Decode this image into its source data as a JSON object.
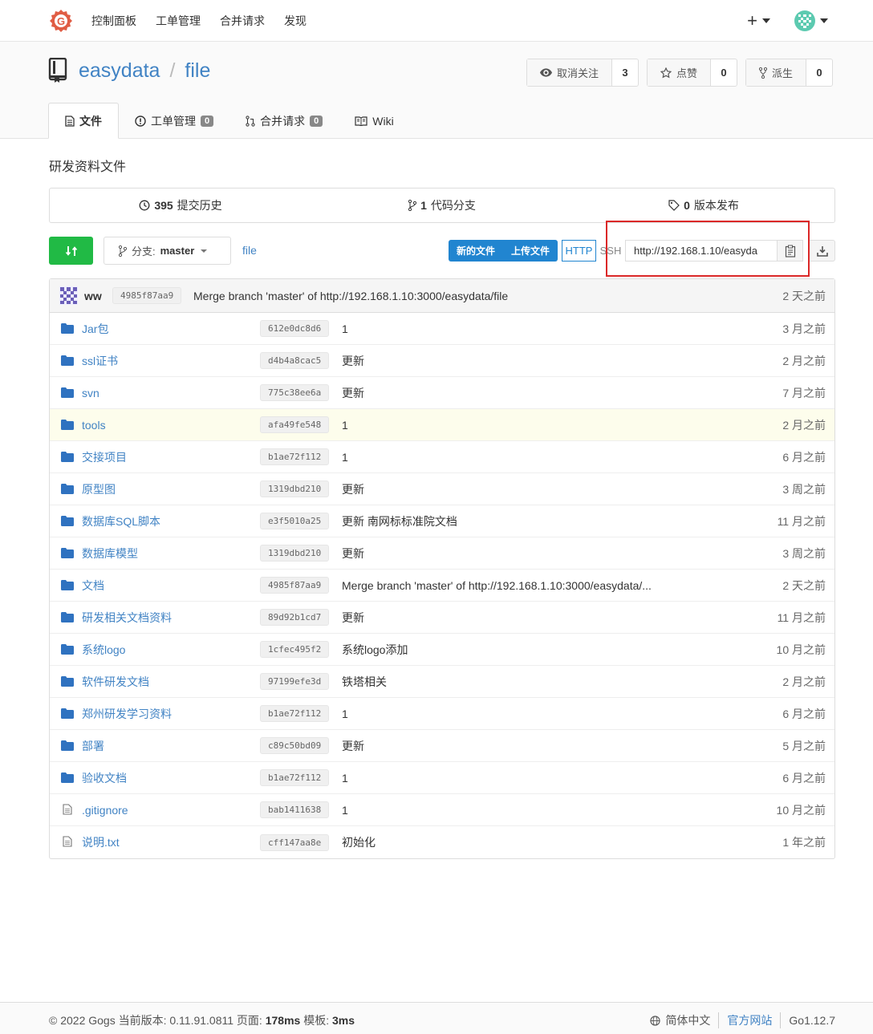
{
  "nav": {
    "items": [
      "控制面板",
      "工单管理",
      "合并请求",
      "发现"
    ],
    "plus": "+"
  },
  "repo": {
    "owner": "easydata",
    "separator": "/",
    "name": "file",
    "description": "研发资料文件",
    "watch": {
      "label": "取消关注",
      "count": "3"
    },
    "star": {
      "label": "点赞",
      "count": "0"
    },
    "fork": {
      "label": "派生",
      "count": "0"
    }
  },
  "tabs": [
    {
      "label": "文件",
      "active": true
    },
    {
      "label": "工单管理",
      "badge": "0"
    },
    {
      "label": "合并请求",
      "badge": "0"
    },
    {
      "label": "Wiki"
    }
  ],
  "stats": {
    "commits": {
      "count": "395",
      "label": "提交历史"
    },
    "branches": {
      "count": "1",
      "label": "代码分支"
    },
    "releases": {
      "count": "0",
      "label": "版本发布"
    }
  },
  "toolbar": {
    "branch_prefix": "分支:",
    "branch": "master",
    "path": "file",
    "new_file": "新的文件",
    "upload_file": "上传文件",
    "http": "HTTP",
    "ssh": "SSH",
    "clone_url": "http://192.168.1.10/easyda"
  },
  "latest_commit": {
    "user": "ww",
    "sha": "4985f87aa9",
    "message": "Merge branch 'master' of http://192.168.1.10:3000/easydata/file",
    "time": "2 天之前"
  },
  "files": [
    {
      "name": "Jar包",
      "type": "dir",
      "sha": "612e0dc8d6",
      "message": "1",
      "time": "3 月之前"
    },
    {
      "name": "ssl证书",
      "type": "dir",
      "sha": "d4b4a8cac5",
      "message": "更新",
      "time": "2 月之前"
    },
    {
      "name": "svn",
      "type": "dir",
      "sha": "775c38ee6a",
      "message": "更新",
      "time": "7 月之前"
    },
    {
      "name": "tools",
      "type": "dir",
      "sha": "afa49fe548",
      "message": "1",
      "time": "2 月之前"
    },
    {
      "name": "交接项目",
      "type": "dir",
      "sha": "b1ae72f112",
      "message": "1",
      "time": "6 月之前"
    },
    {
      "name": "原型图",
      "type": "dir",
      "sha": "1319dbd210",
      "message": "更新",
      "time": "3 周之前"
    },
    {
      "name": "数据库SQL脚本",
      "type": "dir",
      "sha": "e3f5010a25",
      "message": "更新 南网标标准院文档",
      "time": "11 月之前"
    },
    {
      "name": "数据库模型",
      "type": "dir",
      "sha": "1319dbd210",
      "message": "更新",
      "time": "3 周之前"
    },
    {
      "name": "文档",
      "type": "dir",
      "sha": "4985f87aa9",
      "message": "Merge branch 'master' of http://192.168.1.10:3000/easydata/...",
      "time": "2 天之前"
    },
    {
      "name": "研发相关文档资料",
      "type": "dir",
      "sha": "89d92b1cd7",
      "message": "更新",
      "time": "11 月之前"
    },
    {
      "name": "系统logo",
      "type": "dir",
      "sha": "1cfec495f2",
      "message": "系统logo添加",
      "time": "10 月之前"
    },
    {
      "name": "软件研发文档",
      "type": "dir",
      "sha": "97199efe3d",
      "message": "铁塔相关",
      "time": "2 月之前"
    },
    {
      "name": "郑州研发学习资料",
      "type": "dir",
      "sha": "b1ae72f112",
      "message": "1",
      "time": "6 月之前"
    },
    {
      "name": "部署",
      "type": "dir",
      "sha": "c89c50bd09",
      "message": "更新",
      "time": "5 月之前"
    },
    {
      "name": "验收文档",
      "type": "dir",
      "sha": "b1ae72f112",
      "message": "1",
      "time": "6 月之前"
    },
    {
      "name": ".gitignore",
      "type": "file",
      "sha": "bab1411638",
      "message": "1",
      "time": "10 月之前"
    },
    {
      "name": "说明.txt",
      "type": "file",
      "sha": "cff147aa8e",
      "message": "初始化",
      "time": "1 年之前"
    }
  ],
  "footer": {
    "copyright": "© 2022 Gogs 当前版本: 0.11.91.0811 页面:",
    "page_time": "178ms",
    "template_label": "模板:",
    "template_time": "3ms",
    "language": "简体中文",
    "website": "官方网站",
    "go_version": "Go1.12.7"
  },
  "colors": {
    "accent": "#4183c4",
    "primary_button": "#2185d0",
    "compare_button": "#21ba45",
    "highlight_border": "#db2828",
    "logo": "#e05d44"
  }
}
